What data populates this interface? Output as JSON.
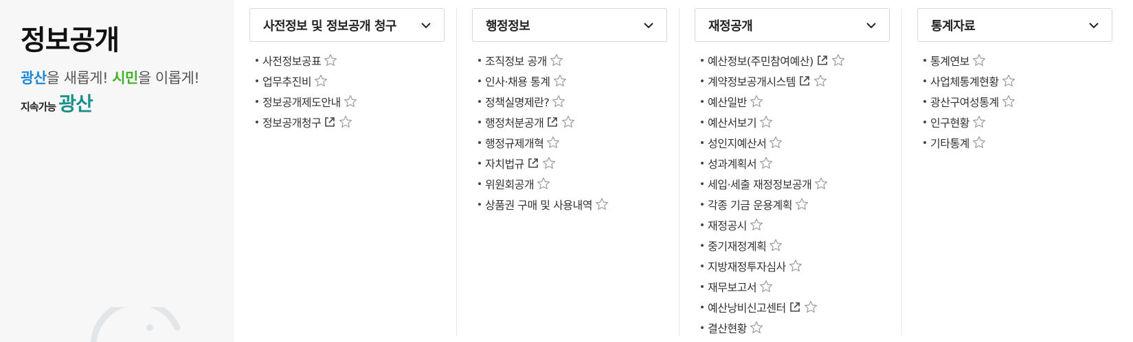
{
  "left": {
    "title": "정보공개",
    "slogan": {
      "part1": "광산",
      "part2": "을 새롭게! ",
      "part3": "시민",
      "part4": "을 이롭게!"
    },
    "brand": {
      "small": "지속가능",
      "big": "광산"
    }
  },
  "colors": {
    "accent_blue": "#1e88d8",
    "accent_green": "#43b02a",
    "brand_teal": "#1a8f8a"
  },
  "columns": [
    {
      "title": "사전정보 및 정보공개 청구",
      "items": [
        {
          "label": "사전정보공표",
          "external": false
        },
        {
          "label": "업무추진비",
          "external": false
        },
        {
          "label": "정보공개제도안내",
          "external": false
        },
        {
          "label": "정보공개청구",
          "external": true
        }
      ]
    },
    {
      "title": "행정정보",
      "items": [
        {
          "label": "조직정보 공개",
          "external": false
        },
        {
          "label": "인사·채용 통계",
          "external": false
        },
        {
          "label": "정책실명제란?",
          "external": false
        },
        {
          "label": "행정처분공개",
          "external": true
        },
        {
          "label": "행정규제개혁",
          "external": false
        },
        {
          "label": "자치법규",
          "external": true
        },
        {
          "label": "위원회공개",
          "external": false
        },
        {
          "label": "상품권 구매 및 사용내역",
          "external": false
        }
      ]
    },
    {
      "title": "재정공개",
      "items": [
        {
          "label": "예산정보(주민참여예산)",
          "external": true
        },
        {
          "label": "계약정보공개시스템",
          "external": true
        },
        {
          "label": "예산일반",
          "external": false
        },
        {
          "label": "예산서보기",
          "external": false
        },
        {
          "label": "성인지예산서",
          "external": false
        },
        {
          "label": "성과계획서",
          "external": false
        },
        {
          "label": "세입·세출 재정정보공개",
          "external": false
        },
        {
          "label": "각종 기금 운용계획",
          "external": false
        },
        {
          "label": "재정공시",
          "external": false
        },
        {
          "label": "중기재정계획",
          "external": false
        },
        {
          "label": "지방재정투자심사",
          "external": false
        },
        {
          "label": "재무보고서",
          "external": false
        },
        {
          "label": "예산낭비신고센터",
          "external": true
        },
        {
          "label": "결산현황",
          "external": false
        }
      ]
    },
    {
      "title": "통계자료",
      "items": [
        {
          "label": "통계연보",
          "external": false
        },
        {
          "label": "사업체통계현황",
          "external": false
        },
        {
          "label": "광산구여성통계",
          "external": false
        },
        {
          "label": "인구현황",
          "external": false
        },
        {
          "label": "기타통계",
          "external": false
        }
      ]
    }
  ]
}
